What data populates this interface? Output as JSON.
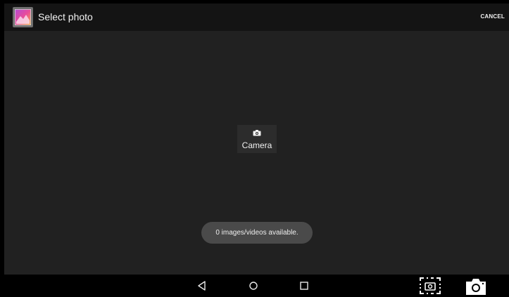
{
  "action_bar": {
    "title": "Select photo",
    "cancel_label": "CANCEL",
    "app_icon": "gallery-icon"
  },
  "main": {
    "camera_button": {
      "icon": "camera-icon",
      "label": "Camera"
    },
    "toast": "0 images/videos available."
  },
  "nav_bar": {
    "buttons": [
      "back-icon",
      "home-icon",
      "recents-icon",
      "screenshot-icon",
      "camera-icon"
    ]
  },
  "colors": {
    "background": "#212121",
    "action_bar": "#141414",
    "nav_bar": "#000000",
    "toast": "#4a4a4a"
  }
}
